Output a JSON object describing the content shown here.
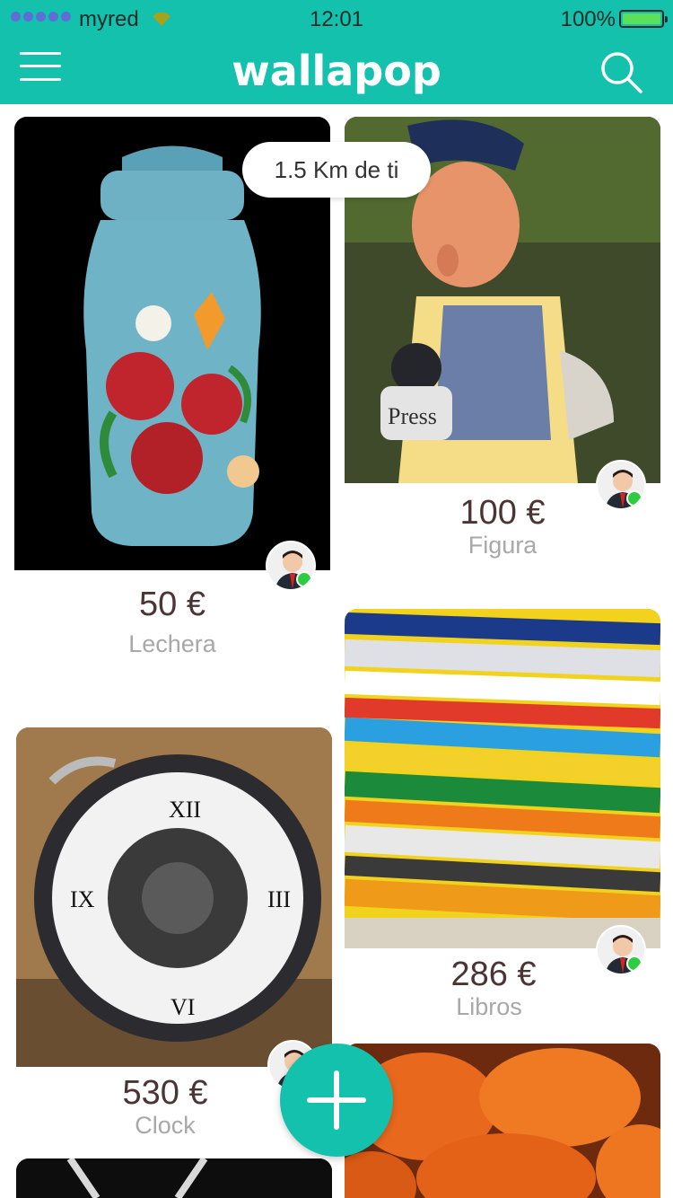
{
  "status_bar": {
    "carrier": "myred",
    "time": "12:01",
    "battery": "100%"
  },
  "header": {
    "brand": "wallapop",
    "menu_icon": "hamburger-menu-icon",
    "search_icon": "search-icon",
    "background_color": "#13c1ac"
  },
  "distance_badge": "1.5 Km de ti",
  "products": [
    {
      "price": "50 €",
      "name": "Lechera"
    },
    {
      "price": "100 €",
      "name": "Figura"
    },
    {
      "price": "286 €",
      "name": "Libros"
    },
    {
      "price": "530 €",
      "name": "Clock"
    }
  ],
  "fab_icon": "plus-icon"
}
